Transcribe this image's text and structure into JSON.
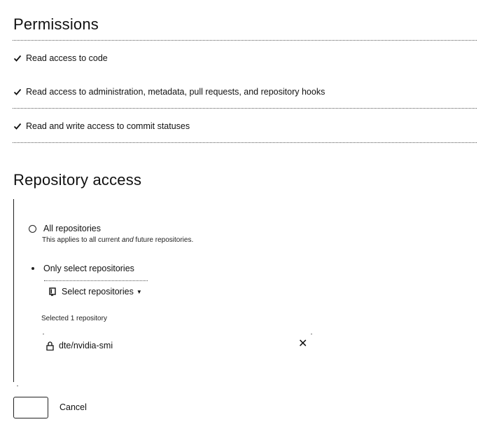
{
  "permissions": {
    "title": "Permissions",
    "items": [
      {
        "label": "Read access to code"
      },
      {
        "label": "Read access to administration, metadata, pull requests, and repository hooks"
      },
      {
        "label": "Read and write access to commit statuses"
      }
    ]
  },
  "repository_access": {
    "title": "Repository access",
    "options": [
      {
        "label": "All repositories",
        "description_prefix": "This applies to all current ",
        "description_em": "and",
        "description_suffix": " future repositories.",
        "selected": false
      },
      {
        "label": "Only select repositories",
        "selected": true
      }
    ],
    "select_button_label": "Select repositories",
    "selected_count_text": "Selected 1 repository",
    "selected_repos": [
      {
        "name": "dte/nvidia-smi"
      }
    ]
  },
  "actions": {
    "confirm_label": "",
    "cancel_label": "Cancel"
  }
}
